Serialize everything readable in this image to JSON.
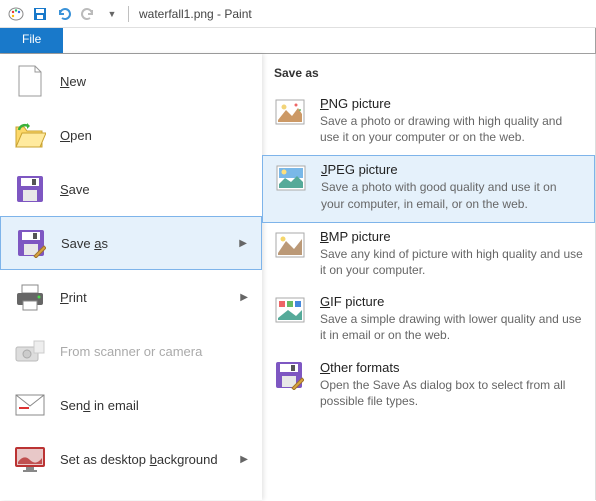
{
  "window": {
    "title": "waterfall1.png - Paint",
    "file_tab": "File"
  },
  "left_menu": {
    "new": "New",
    "open": "Open",
    "save": "Save",
    "save_as": "Save as",
    "print": "Print",
    "scanner": "From scanner or camera",
    "email": "Send in email",
    "desktop": "Set as desktop background"
  },
  "right_panel": {
    "heading": "Save as",
    "png": {
      "title": "PNG picture",
      "desc": "Save a photo or drawing with high quality and use it on your computer or on the web."
    },
    "jpeg": {
      "title": "JPEG picture",
      "desc": "Save a photo with good quality and use it on your computer, in email, or on the web."
    },
    "bmp": {
      "title": "BMP picture",
      "desc": "Save any kind of picture with high quality and use it on your computer."
    },
    "gif": {
      "title": "GIF picture",
      "desc": "Save a simple drawing with lower quality and use it in email or on the web."
    },
    "other": {
      "title": "Other formats",
      "desc": "Open the Save As dialog box to select from all possible file types."
    }
  }
}
